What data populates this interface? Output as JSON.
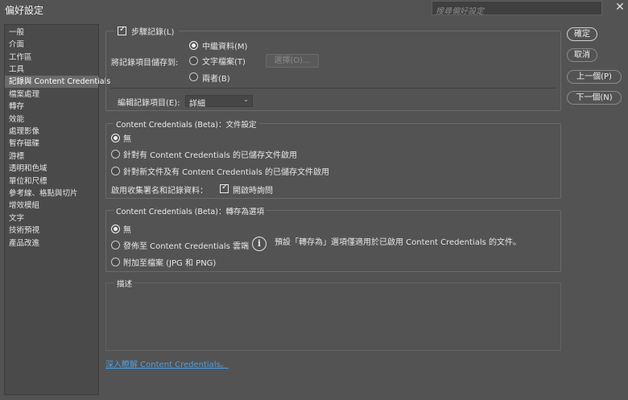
{
  "window": {
    "title": "偏好設定",
    "search_placeholder": "搜尋偏好設定",
    "close_glyph": "✕"
  },
  "sidebar": {
    "items": [
      {
        "label": "一般",
        "selected": false
      },
      {
        "label": "介面",
        "selected": false
      },
      {
        "label": "工作區",
        "selected": false
      },
      {
        "label": "工具",
        "selected": false
      },
      {
        "label": "記錄與 Content Credentials",
        "selected": true
      },
      {
        "label": "檔案處理",
        "selected": false
      },
      {
        "label": "轉存",
        "selected": false
      },
      {
        "label": "效能",
        "selected": false
      },
      {
        "label": "處理影像",
        "selected": false
      },
      {
        "label": "暫存磁碟",
        "selected": false
      },
      {
        "label": "游標",
        "selected": false
      },
      {
        "label": "透明和色域",
        "selected": false
      },
      {
        "label": "單位和尺標",
        "selected": false
      },
      {
        "label": "參考線、格點與切片",
        "selected": false
      },
      {
        "label": "增效模組",
        "selected": false
      },
      {
        "label": "文字",
        "selected": false
      },
      {
        "label": "技術預視",
        "selected": false
      },
      {
        "label": "產品改進",
        "selected": false
      }
    ]
  },
  "history": {
    "step_log_label": "步驟記錄(L)",
    "step_log_checked": true,
    "save_to_label": "將記錄項目儲存到:",
    "option_metadata": "中繼資料(M)",
    "option_textfile": "文字檔案(T)",
    "option_both": "兩者(B)",
    "selected_option": "metadata",
    "choose_button": "選擇(O)...",
    "edit_log_label": "編輯記錄項目(E):",
    "edit_log_value": "詳細"
  },
  "cc_docs": {
    "legend": "Content Credentials (Beta)：文件設定",
    "option_none": "無",
    "option_saved": "針對有 Content Credentials 的已儲存文件啟用",
    "option_new": "針對新文件及有 Content Credentials 的已儲存文件啟用",
    "selected_option": "none",
    "collect_label": "啟用收集署名和記錄資料：",
    "ask_on_open_label": "開啟時詢問",
    "ask_on_open_checked": true
  },
  "cc_export": {
    "legend": "Content Credentials (Beta)：轉存為選項",
    "option_none": "無",
    "option_publish": "發佈至 Content Credentials 雲端",
    "option_attach": "附加至檔案 (JPG 和 PNG)",
    "selected_option": "none",
    "info_icon": "info-icon",
    "info_text": "預設「轉存為」選項僅適用於已啟用 Content Credentials 的文件。"
  },
  "description": {
    "legend": "描述"
  },
  "learn_more_link": "深入瞭解 Content Credentials。",
  "buttons": {
    "ok": "確定",
    "cancel": "取消",
    "prev": "上一個(P)",
    "next": "下一個(N)"
  },
  "colors": {
    "background": "#535353",
    "sidebar_bg": "#4a4a4a",
    "selected_item": "#6a6a6a",
    "link": "#4fa0e0"
  }
}
